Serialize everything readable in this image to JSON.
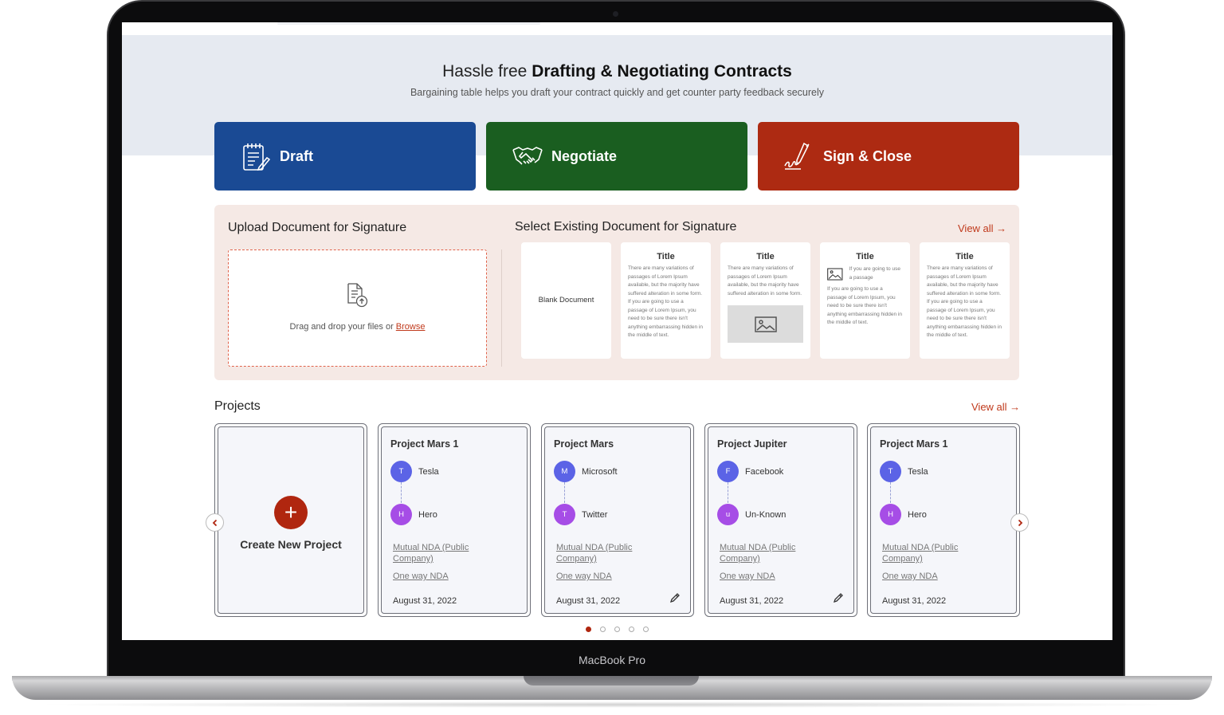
{
  "device_label": "MacBook Pro",
  "hero": {
    "title_prefix": "Hassle free ",
    "title_bold": "Drafting & Negotiating Contracts",
    "subtitle": "Bargaining table helps you draft your contract quickly and get counter party feedback securely"
  },
  "actions": [
    {
      "label": "Draft",
      "color": "#1a4a94",
      "icon": "notepad-icon"
    },
    {
      "label": "Negotiate",
      "color": "#1a5e20",
      "icon": "handshake-icon"
    },
    {
      "label": "Sign & Close",
      "color": "#ad2a12",
      "icon": "signature-pen-icon"
    }
  ],
  "upload": {
    "heading": "Upload Document for Signature",
    "drop_text": "Drag and drop your files or ",
    "browse_label": "Browse"
  },
  "existing": {
    "heading": "Select Existing Document for Signature",
    "view_all": "View all →",
    "blank_label": "Blank Document",
    "docs": [
      {
        "title": "Title",
        "para1": "There are many variations of passages of Lorem Ipsum available, but the majority have suffered alteration in some form.",
        "para2": "If you are going to use a passage of Lorem Ipsum, you need to be sure there isn't anything embarrassing hidden in the middle of text."
      },
      {
        "title": "Title",
        "para1": "There are many variations of passages of Lorem Ipsum available, but the majority have suffered alteration in some form."
      },
      {
        "title": "Title",
        "para1": "If you are going to use a passage",
        "para2": "If you are going to use a passage of Lorem Ipsum, you need to be sure there isn't anything embarrassing hidden in the middle of text."
      },
      {
        "title": "Title",
        "para1": "There are many variations of passages of Lorem Ipsum available, but the majority have suffered alteration in some form.",
        "para2": "If you are going to use a passage of Lorem Ipsum, you need to be sure there isn't anything embarrassing hidden in the middle of text."
      }
    ]
  },
  "projects": {
    "heading": "Projects",
    "view_all": "View all →",
    "create_label": "Create New Project",
    "items": [
      {
        "name": "Project Mars 1",
        "p1": {
          "initial": "T",
          "name": "Tesla",
          "color": "#5b63e6"
        },
        "p2": {
          "initial": "H",
          "name": "Hero",
          "color": "#a64de6"
        },
        "link1": "Mutual NDA (Public Company)",
        "link2": "One way NDA",
        "date": "August 31, 2022",
        "editable": false
      },
      {
        "name": "Project Mars",
        "p1": {
          "initial": "M",
          "name": "Microsoft",
          "color": "#5b63e6"
        },
        "p2": {
          "initial": "T",
          "name": "Twitter",
          "color": "#a64de6"
        },
        "link1": "Mutual NDA (Public Company)",
        "link2": "One way NDA",
        "date": "August 31, 2022",
        "editable": true
      },
      {
        "name": "Project Jupiter",
        "p1": {
          "initial": "F",
          "name": "Facebook",
          "color": "#5b63e6"
        },
        "p2": {
          "initial": "u",
          "name": "Un-Known",
          "color": "#a64de6"
        },
        "link1": "Mutual NDA (Public Company)",
        "link2": "One way NDA",
        "date": "August 31, 2022",
        "editable": true
      },
      {
        "name": "Project Mars 1",
        "p1": {
          "initial": "T",
          "name": "Tesla",
          "color": "#5b63e6"
        },
        "p2": {
          "initial": "H",
          "name": "Hero",
          "color": "#a64de6"
        },
        "link1": "Mutual NDA (Public Company)",
        "link2": "One way NDA",
        "date": "August 31, 2022",
        "editable": false
      }
    ],
    "pagination": {
      "pages": 5,
      "active": 1
    }
  }
}
